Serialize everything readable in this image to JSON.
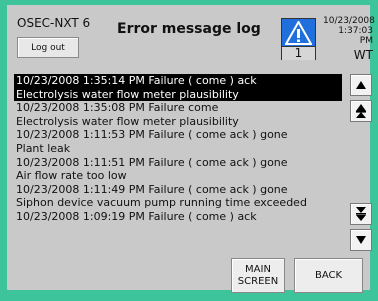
{
  "header": {
    "station": "OSEC-NXT 6",
    "logout_label": "Log out",
    "title": "Error message log",
    "alarm_count": "1",
    "date": "10/23/2008",
    "time": "1:37:03 PM",
    "user": "WT"
  },
  "messages": [
    {
      "line1": "10/23/2008 1:35:14 PM Failure ( come ) ack",
      "line2": "Electrolysis water flow meter plausibility"
    },
    {
      "line1": "10/23/2008 1:35:08 PM Failure  come",
      "line2": "Electrolysis water flow meter plausibility"
    },
    {
      "line1": "10/23/2008 1:11:53 PM Failure ( come  ack ) gone",
      "line2": "Plant leak"
    },
    {
      "line1": "10/23/2008 1:11:51 PM Failure ( come  ack ) gone",
      "line2": "Air flow rate too low"
    },
    {
      "line1": "10/23/2008 1:11:49 PM Failure ( come  ack ) gone",
      "line2": "Siphon device vacuum pump running time exceeded"
    },
    {
      "line1": "10/23/2008 1:09:19 PM Failure ( come ) ack",
      "line2": ""
    }
  ],
  "buttons": {
    "main_screen_line1": "MAIN",
    "main_screen_line2": "SCREEN",
    "back": "BACK"
  },
  "icons": {
    "alarm": "warning-triangle-icon",
    "scroll_up": "arrow-up-icon",
    "page_up": "double-arrow-up-icon",
    "page_down": "double-arrow-down-icon",
    "scroll_down": "arrow-down-icon"
  },
  "colors": {
    "frame": "#3ec49a",
    "panel": "#c9c9c9",
    "alarm_blue": "#1f6fdc",
    "selected_row": "#000000"
  }
}
